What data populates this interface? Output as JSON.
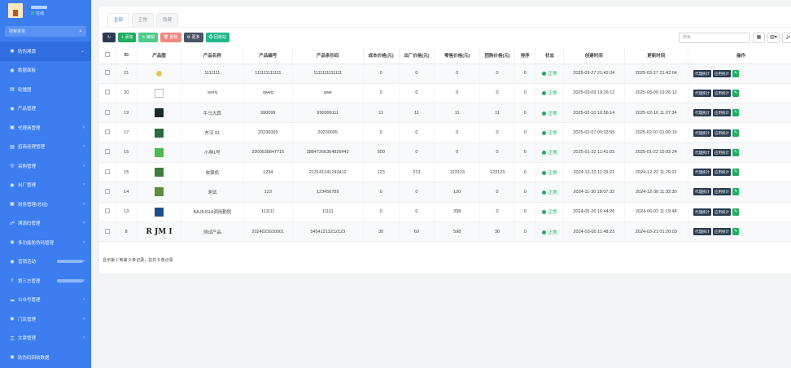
{
  "sidebar": {
    "logo_status": "在线",
    "search_placeholder": "搜索菜单",
    "items": [
      {
        "icon": "◉",
        "label": "防伪溯源",
        "arrow": "⌄",
        "active": true
      },
      {
        "icon": "◉",
        "label": "数据面板",
        "arrow": ""
      },
      {
        "icon": "▤",
        "label": "轮播图",
        "arrow": ""
      },
      {
        "icon": "◉",
        "label": "产品管理",
        "arrow": ""
      },
      {
        "icon": "▣",
        "label": "代理商管理",
        "arrow": "‹"
      },
      {
        "icon": "▤",
        "label": "招商经理管理",
        "arrow": "‹"
      },
      {
        "icon": "◎",
        "label": "采购管理",
        "arrow": "‹"
      },
      {
        "icon": "◉",
        "label": "出厂管理",
        "arrow": "‹"
      },
      {
        "icon": "▣",
        "label": "财务管理(总经)",
        "arrow": "‹"
      },
      {
        "icon": "☍",
        "label": "溯源码管理",
        "arrow": "‹"
      },
      {
        "icon": "◉",
        "label": "多功能防伪码管理",
        "arrow": "‹"
      },
      {
        "icon": "◉",
        "label": "营销活动",
        "arrow": "‹",
        "blur": true
      },
      {
        "icon": "⚕",
        "label": "第三方管理",
        "arrow": "‹",
        "blur": true
      },
      {
        "icon": "☁",
        "label": "公众号管理",
        "arrow": "‹"
      },
      {
        "icon": "◉",
        "label": "门店管理",
        "arrow": "‹"
      },
      {
        "icon": "工",
        "label": "文章管理",
        "arrow": "‹"
      },
      {
        "icon": "◉",
        "label": "防伪码回收数据",
        "arrow": ""
      }
    ]
  },
  "tabs": [
    "全部",
    "正常",
    "隐藏"
  ],
  "toolbar": {
    "refresh": "↻",
    "add": "+ 添加",
    "edit": "✎ 编辑",
    "delete": "🗑 删除",
    "more": "⚙ 更多",
    "recycle": "♻ 回收站",
    "search_placeholder": "搜索",
    "view_icon": "▦",
    "columns_icon": "▥▾",
    "export_icon": "⤓▾"
  },
  "table": {
    "headers": [
      "",
      "ID",
      "产品图",
      "产品名称",
      "产品编号",
      "产品条形码",
      "成本价格(元)",
      "出厂价格(元)",
      "零售价格(元)",
      "团购价格(元)",
      "排序",
      "状态",
      "创建时间",
      "更新时间",
      "操作"
    ],
    "rows": [
      {
        "id": "21",
        "thumb": "#e8c55a",
        "name": "1111111",
        "code": "111111111111",
        "barcode": "1111111111111",
        "cost": "0",
        "factory": "0",
        "retail": "0",
        "group": "0",
        "sort": "0",
        "status": "正常",
        "created": "2025-03-27 21:42:04",
        "updated": "2025-03-27 21:42:04"
      },
      {
        "id": "20",
        "thumb": "#ffffff",
        "name": "werq",
        "code": "qweq",
        "barcode": "qwe",
        "cost": "0",
        "factory": "0",
        "retail": "0",
        "group": "0",
        "sort": "0",
        "status": "正常",
        "created": "2025-03-09 19:26:12",
        "updated": "2025-03-09 19:26:12"
      },
      {
        "id": "19",
        "thumb": "#1c2a2a",
        "name": "牛马大蒜",
        "code": "990099",
        "barcode": "990099111",
        "cost": "11",
        "factory": "11",
        "retail": "11",
        "group": "11",
        "sort": "0",
        "status": "正常",
        "created": "2025-02-10 10:56:14",
        "updated": "2025-02-10 11:27:34"
      },
      {
        "id": "17",
        "thumb": "#2c6b3c",
        "name": "东汉 91",
        "code": "20230005",
        "barcode": "20230005",
        "cost": "0",
        "factory": "0",
        "retail": "0",
        "group": "0",
        "sort": "0",
        "status": "正常",
        "created": "2025-02-07 00:03:55",
        "updated": "2025-02-07 01:00:16"
      },
      {
        "id": "16",
        "thumb": "#4fb84f",
        "name": "小种1号",
        "code": "2000938847716",
        "barcode": "38847266364826442",
        "cost": "500",
        "factory": "0",
        "retail": "0",
        "group": "0",
        "sort": "0",
        "status": "正常",
        "created": "2025-01-22 11:41:03",
        "updated": "2025-01-22 15:02:24"
      },
      {
        "id": "15",
        "thumb": "#3f7d3a",
        "name": "收银机",
        "code": "1234",
        "barcode": "213141241243412",
        "cost": "123",
        "factory": "213",
        "retail": "123123",
        "group": "123123",
        "sort": "0",
        "status": "正常",
        "created": "2024-12-22 11:29:22",
        "updated": "2024-12-22 11:29:22"
      },
      {
        "id": "14",
        "thumb": "#5a8f3e",
        "name": "测试",
        "code": "123",
        "barcode": "123456789",
        "cost": "0",
        "factory": "0",
        "retail": "120",
        "group": "0",
        "sort": "0",
        "status": "正常",
        "created": "2024-11-30 18:07:32",
        "updated": "2024-12-30 11:32:30"
      },
      {
        "id": "13",
        "thumb": "#1d4f8a",
        "name": "BAJIUSHI调用勤刨",
        "code": "111111",
        "barcode": "11111",
        "cost": "0",
        "factory": "0",
        "retail": "398",
        "group": "0",
        "sort": "0",
        "status": "正常",
        "created": "2024-05-26 16:44:26",
        "updated": "2024-06-03 11:19:48"
      },
      {
        "id": "8",
        "thumb": "logo",
        "thumb_text": "R JM I",
        "name": "测试产品",
        "code": "2024021610001",
        "barcode": "54541213212123",
        "cost": "30",
        "factory": "60",
        "retail": "598",
        "group": "30",
        "sort": "0",
        "status": "正常",
        "created": "2024-03-05 11:48:23",
        "updated": "2024-03-21 01:20:03"
      }
    ],
    "action_proxy": "代理统计",
    "action_app": "应用统计",
    "action_edit": "✎"
  },
  "footer": "显示第 1 到第 9 条记录，总共 9 条记录"
}
